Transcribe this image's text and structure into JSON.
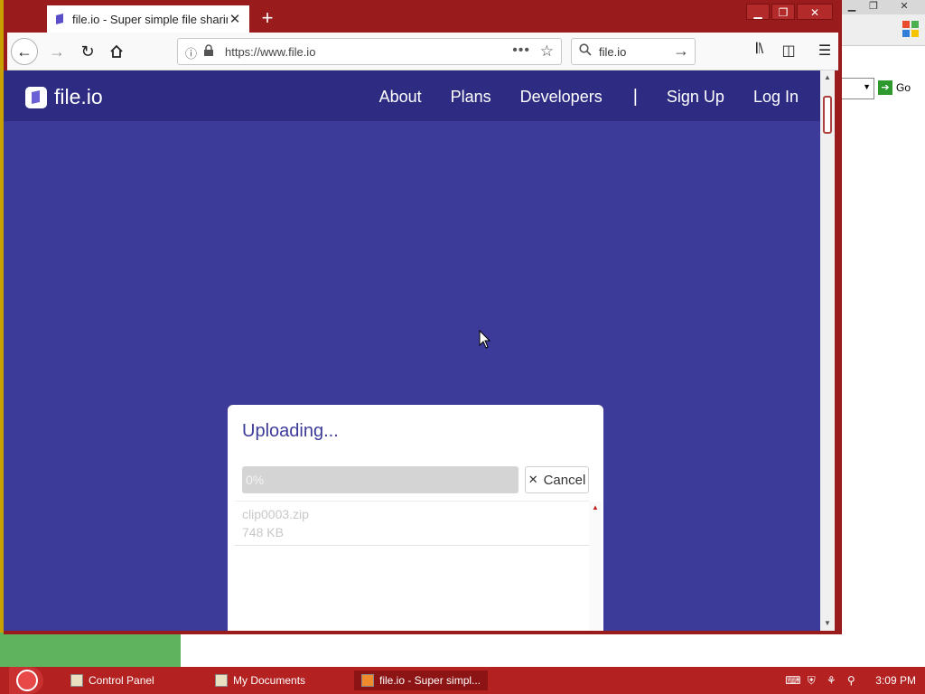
{
  "browser": {
    "tab_title": "file.io - Super simple file sharin",
    "new_tab_symbol": "+",
    "url": "https://www.file.io",
    "search_query": "file.io"
  },
  "site": {
    "logo_text": "file.io",
    "nav": {
      "about": "About",
      "plans": "Plans",
      "developers": "Developers",
      "divider": "|",
      "signup": "Sign Up",
      "login": "Log In"
    },
    "colors": {
      "header_bg": "#2e2c82",
      "page_bg": "#3d3b99"
    }
  },
  "upload": {
    "title": "Uploading...",
    "progress_percent": 0,
    "progress_label": "0%",
    "cancel_label": "Cancel",
    "files": [
      {
        "name": "clip0003.zip",
        "size": "748 KB"
      }
    ]
  },
  "background_window": {
    "go_label": "Go"
  },
  "taskbar": {
    "items": [
      {
        "label": "Control Panel"
      },
      {
        "label": "My Documents"
      },
      {
        "label": "file.io - Super simpl..."
      }
    ],
    "clock": "3:09 PM"
  }
}
